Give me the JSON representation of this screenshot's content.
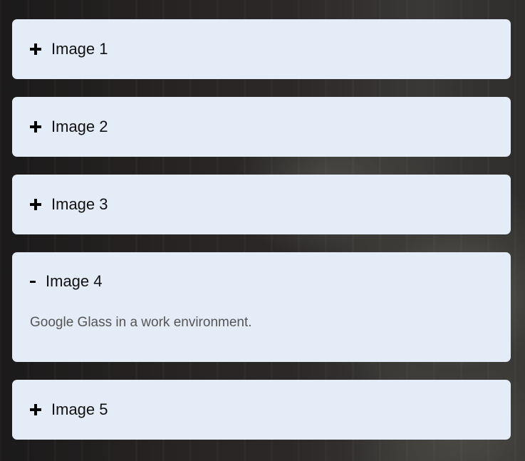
{
  "accordion": {
    "items": [
      {
        "title": "Image 1",
        "toggle": "+",
        "expanded": false
      },
      {
        "title": "Image 2",
        "toggle": "+",
        "expanded": false
      },
      {
        "title": "Image 3",
        "toggle": "+",
        "expanded": false
      },
      {
        "title": "Image 4",
        "toggle": "-",
        "expanded": true,
        "content": "Google Glass in a work environment."
      },
      {
        "title": "Image 5",
        "toggle": "+",
        "expanded": false
      }
    ]
  },
  "colors": {
    "panel_background": "#e3ecf7",
    "title_text": "#111111",
    "body_text": "#555555",
    "icon": "#000000"
  },
  "icons": {
    "collapsed": "plus-icon",
    "expanded": "minus-icon"
  }
}
